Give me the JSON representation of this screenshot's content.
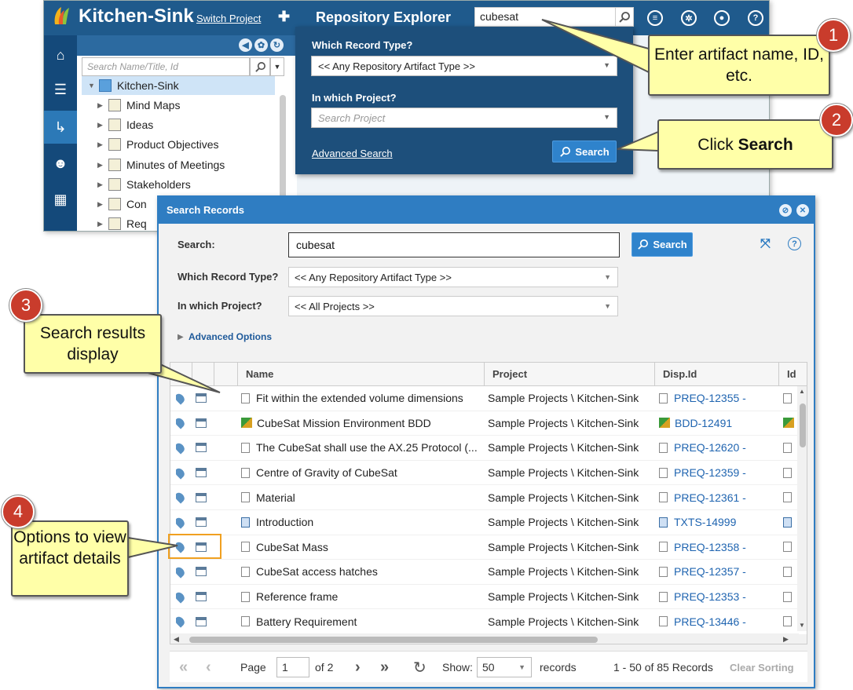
{
  "app": {
    "title": "Kitchen-Sink",
    "switch_project": "Switch Project",
    "explorer_title": "Repository Explorer",
    "global_search_value": "cubesat"
  },
  "tree": {
    "search_placeholder": "Search Name/Title, Id",
    "root": "Kitchen-Sink",
    "items": [
      "Mind Maps",
      "Ideas",
      "Product Objectives",
      "Minutes of Meetings",
      "Stakeholders",
      "Con",
      "Req"
    ]
  },
  "quick_search": {
    "record_type_label": "Which Record Type?",
    "record_type_value": "<< Any Repository Artifact Type >>",
    "project_label": "In which Project?",
    "project_placeholder": "Search Project",
    "advanced_link": "Advanced Search",
    "search_button": "Search"
  },
  "dialog": {
    "title": "Search Records",
    "search_label": "Search:",
    "search_value": "cubesat",
    "search_button": "Search",
    "record_type_label": "Which Record Type?",
    "record_type_value": "<< Any Repository Artifact Type >>",
    "project_label": "In which Project?",
    "project_value": "<< All Projects >>",
    "advanced_options": "Advanced Options",
    "columns": [
      "Name",
      "Project",
      "Disp.Id",
      "Id"
    ],
    "rows": [
      {
        "name": "Fit within the extended volume dimensions",
        "project": "Sample Projects \\ Kitchen-Sink",
        "disp_id": "PREQ-12355 -",
        "icon": "doc"
      },
      {
        "name": "CubeSat Mission Environment BDD",
        "project": "Sample Projects \\ Kitchen-Sink",
        "disp_id": "BDD-12491",
        "icon": "cube"
      },
      {
        "name": "The CubeSat shall use the AX.25 Protocol (...",
        "project": "Sample Projects \\ Kitchen-Sink",
        "disp_id": "PREQ-12620 -",
        "icon": "doc"
      },
      {
        "name": "Centre of Gravity of CubeSat",
        "project": "Sample Projects \\ Kitchen-Sink",
        "disp_id": "PREQ-12359 -",
        "icon": "doc"
      },
      {
        "name": "Material",
        "project": "Sample Projects \\ Kitchen-Sink",
        "disp_id": "PREQ-12361 -",
        "icon": "doc"
      },
      {
        "name": "Introduction",
        "project": "Sample Projects \\ Kitchen-Sink",
        "disp_id": "TXTS-14999",
        "icon": "txt"
      },
      {
        "name": "CubeSat Mass",
        "project": "Sample Projects \\ Kitchen-Sink",
        "disp_id": "PREQ-12358 -",
        "icon": "doc"
      },
      {
        "name": "CubeSat access hatches",
        "project": "Sample Projects \\ Kitchen-Sink",
        "disp_id": "PREQ-12357 -",
        "icon": "doc"
      },
      {
        "name": "Reference frame",
        "project": "Sample Projects \\ Kitchen-Sink",
        "disp_id": "PREQ-12353 -",
        "icon": "doc"
      },
      {
        "name": "Battery Requirement",
        "project": "Sample Projects \\ Kitchen-Sink",
        "disp_id": "PREQ-13446 -",
        "icon": "doc"
      }
    ],
    "pager": {
      "page_label": "Page",
      "page_value": "1",
      "of_label": "of 2",
      "show_label": "Show:",
      "show_value": "50",
      "records_label": "records",
      "summary": "1 - 50 of 85 Records",
      "clear_sorting": "Clear Sorting"
    }
  },
  "callouts": [
    {
      "num": "1",
      "text": "Enter artifact name, ID, etc."
    },
    {
      "num": "2",
      "text_pre": "Click ",
      "text_bold": "Search"
    },
    {
      "num": "3",
      "text": "Search results display"
    },
    {
      "num": "4",
      "text": "Options to view artifact details"
    }
  ],
  "colors": {
    "header": "#1f5a8c",
    "accent": "#2f7dc2",
    "callout_bg": "#ffffa8",
    "badge": "#c93c2c",
    "highlight": "#f0a020"
  }
}
